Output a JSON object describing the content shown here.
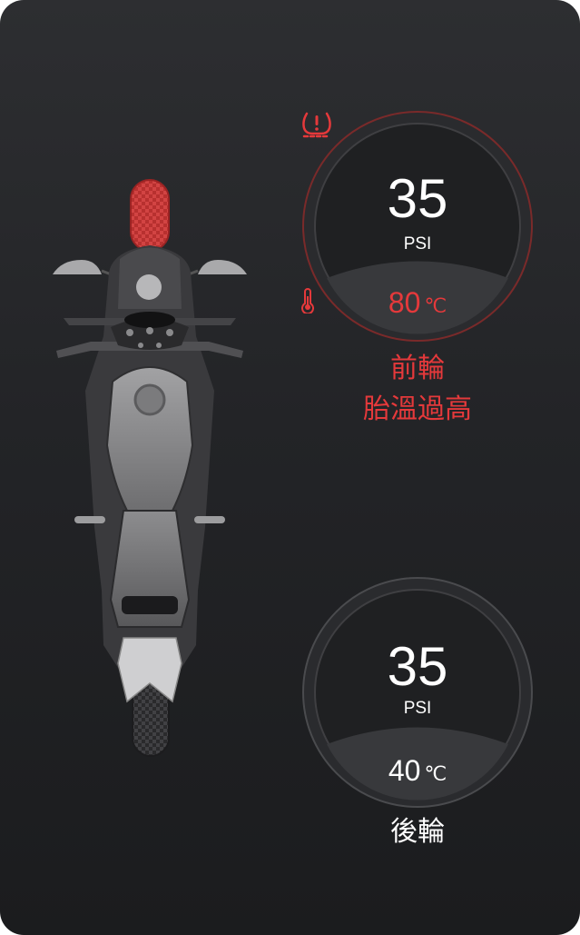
{
  "colors": {
    "alert": "#e5393b",
    "normal": "#ffffff",
    "background": "#232427"
  },
  "front_tire": {
    "alert_icon": "tire-pressure-warning-icon",
    "pressure": "35",
    "pressure_unit": "PSI",
    "temp_icon": "thermometer-icon",
    "temperature": "80",
    "temperature_unit": "℃",
    "label": "前輪",
    "status": "胎溫過高"
  },
  "rear_tire": {
    "pressure": "35",
    "pressure_unit": "PSI",
    "temperature": "40",
    "temperature_unit": "℃",
    "label": "後輪"
  }
}
